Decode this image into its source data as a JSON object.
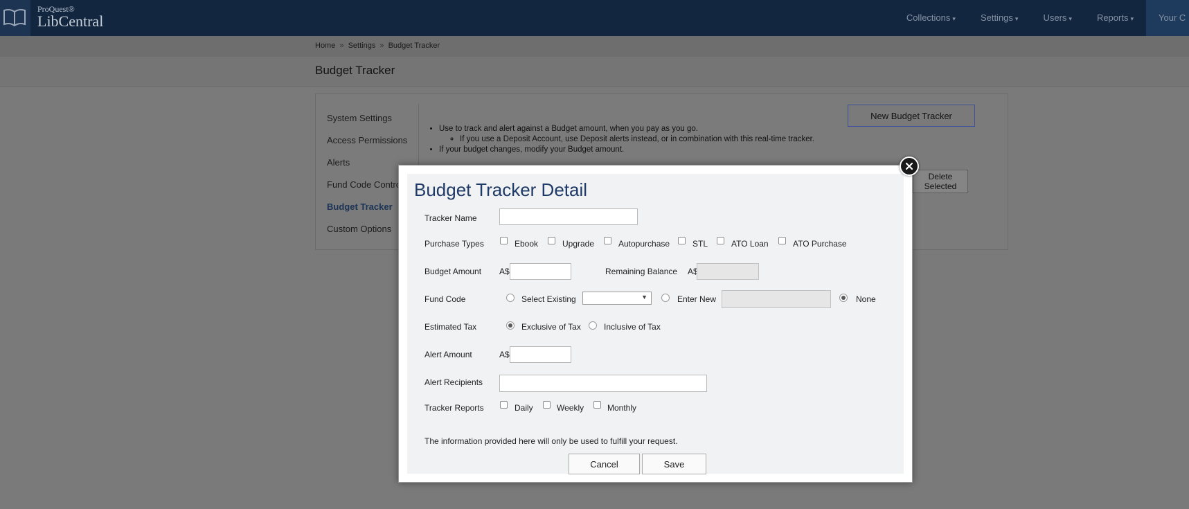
{
  "header": {
    "logo_small": "ProQuest®",
    "logo_big": "LibCentral",
    "nav": [
      "Collections",
      "Settings",
      "Users",
      "Reports",
      "Your C"
    ]
  },
  "breadcrumb": {
    "home": "Home",
    "settings": "Settings",
    "current": "Budget Tracker"
  },
  "page": {
    "title": "Budget Tracker"
  },
  "sidebar": {
    "items": [
      {
        "label": "System Settings"
      },
      {
        "label": "Access Permissions"
      },
      {
        "label": "Alerts"
      },
      {
        "label": "Fund Code Controls"
      },
      {
        "label": "Budget Tracker"
      },
      {
        "label": "Custom Options"
      }
    ],
    "active": "Budget Tracker"
  },
  "info": {
    "line1": "Use to track and alert against a Budget amount, when you pay as you go.",
    "line1_sub": "If you use a Deposit Account, use Deposit alerts instead, or in combination with this real-time tracker.",
    "line2": "If your budget changes, modify your Budget amount."
  },
  "buttons": {
    "new_tracker": "New Budget Tracker",
    "delete_line1": "Delete",
    "delete_line2": "Selected"
  },
  "modal": {
    "title": "Budget Tracker Detail",
    "tracker_name_label": "Tracker Name",
    "tracker_name_value": "",
    "purchase_types_label": "Purchase Types",
    "purchase_types": [
      "Ebook",
      "Upgrade",
      "Autopurchase",
      "STL",
      "ATO Loan",
      "ATO Purchase"
    ],
    "budget_amount_label": "Budget Amount",
    "currency": "A$",
    "budget_amount_value": "",
    "remaining_balance_label": "Remaining Balance",
    "remaining_balance_value": "",
    "fund_code_label": "Fund Code",
    "fund_code_options": [
      "Select Existing",
      "Enter New",
      "None"
    ],
    "fund_code_selected": "None",
    "estimated_tax_label": "Estimated Tax",
    "tax_options": [
      "Exclusive of Tax",
      "Inclusive of Tax"
    ],
    "tax_selected": "Exclusive of Tax",
    "alert_amount_label": "Alert Amount",
    "alert_amount_value": "",
    "alert_recipients_label": "Alert Recipients",
    "alert_recipients_value": "",
    "tracker_reports_label": "Tracker Reports",
    "report_options": [
      "Daily",
      "Weekly",
      "Monthly"
    ],
    "disclaimer": "The information provided here will only be used to fulfill your request.",
    "cancel_label": "Cancel",
    "save_label": "Save"
  }
}
